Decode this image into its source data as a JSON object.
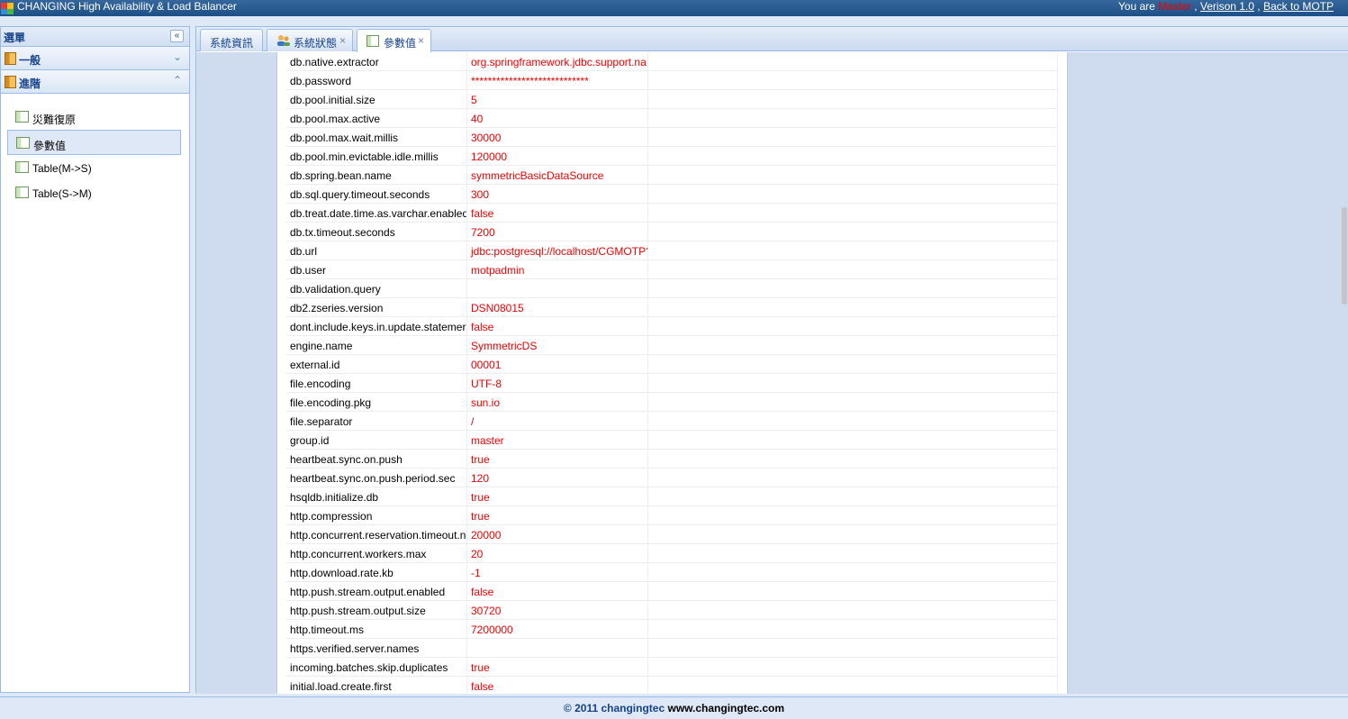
{
  "header": {
    "title": "CHANGING High Availability & Load Balancer",
    "you_are": "You are",
    "role": "Master",
    "sep1": ",",
    "version": "Verison 1.0",
    "sep2": ",",
    "back": "Back to MOTP"
  },
  "sidebar": {
    "title": "選單",
    "sections": [
      {
        "label": "一般",
        "state": "collapsed"
      },
      {
        "label": "進階",
        "state": "expanded"
      }
    ],
    "items": [
      {
        "label": "災難復原"
      },
      {
        "label": "參數值",
        "selected": true
      },
      {
        "label": "Table(M->S)"
      },
      {
        "label": "Table(S->M)"
      }
    ]
  },
  "tabs": [
    {
      "label": "系統資訊"
    },
    {
      "label": "系統狀態"
    },
    {
      "label": "參數值",
      "active": true
    }
  ],
  "params": [
    {
      "key": "db.native.extractor",
      "value": "org.springframework.jdbc.support.na"
    },
    {
      "key": "db.password",
      "value": "****************************"
    },
    {
      "key": "db.pool.initial.size",
      "value": "5"
    },
    {
      "key": "db.pool.max.active",
      "value": "40"
    },
    {
      "key": "db.pool.max.wait.millis",
      "value": "30000"
    },
    {
      "key": "db.pool.min.evictable.idle.millis",
      "value": "120000"
    },
    {
      "key": "db.spring.bean.name",
      "value": "symmetricBasicDataSource"
    },
    {
      "key": "db.sql.query.timeout.seconds",
      "value": "300"
    },
    {
      "key": "db.treat.date.time.as.varchar.enabled",
      "value": "false"
    },
    {
      "key": "db.tx.timeout.seconds",
      "value": "7200"
    },
    {
      "key": "db.url",
      "value": "jdbc:postgresql://localhost/CGMOTP?"
    },
    {
      "key": "db.user",
      "value": "motpadmin"
    },
    {
      "key": "db.validation.query",
      "value": ""
    },
    {
      "key": "db2.zseries.version",
      "value": "DSN08015"
    },
    {
      "key": "dont.include.keys.in.update.statemer",
      "value": "false"
    },
    {
      "key": "engine.name",
      "value": "SymmetricDS"
    },
    {
      "key": "external.id",
      "value": "00001"
    },
    {
      "key": "file.encoding",
      "value": "UTF-8"
    },
    {
      "key": "file.encoding.pkg",
      "value": "sun.io"
    },
    {
      "key": "file.separator",
      "value": "/"
    },
    {
      "key": "group.id",
      "value": "master"
    },
    {
      "key": "heartbeat.sync.on.push",
      "value": "true"
    },
    {
      "key": "heartbeat.sync.on.push.period.sec",
      "value": "120"
    },
    {
      "key": "hsqldb.initialize.db",
      "value": "true"
    },
    {
      "key": "http.compression",
      "value": "true"
    },
    {
      "key": "http.concurrent.reservation.timeout.n",
      "value": "20000"
    },
    {
      "key": "http.concurrent.workers.max",
      "value": "20"
    },
    {
      "key": "http.download.rate.kb",
      "value": "-1"
    },
    {
      "key": "http.push.stream.output.enabled",
      "value": "false"
    },
    {
      "key": "http.push.stream.output.size",
      "value": "30720"
    },
    {
      "key": "http.timeout.ms",
      "value": "7200000"
    },
    {
      "key": "https.verified.server.names",
      "value": ""
    },
    {
      "key": "incoming.batches.skip.duplicates",
      "value": "true"
    },
    {
      "key": "initial.load.create.first",
      "value": "false"
    }
  ],
  "footer": {
    "copyright": "© 2011 changingtec",
    "site": "www.changingtec.com"
  },
  "icons": {
    "logo": "cube-logo-icon",
    "collapse": "double-chevron-left-icon",
    "folder": "folder-icon",
    "tree": "grid-icon",
    "people": "users-icon",
    "close": "close-icon"
  }
}
